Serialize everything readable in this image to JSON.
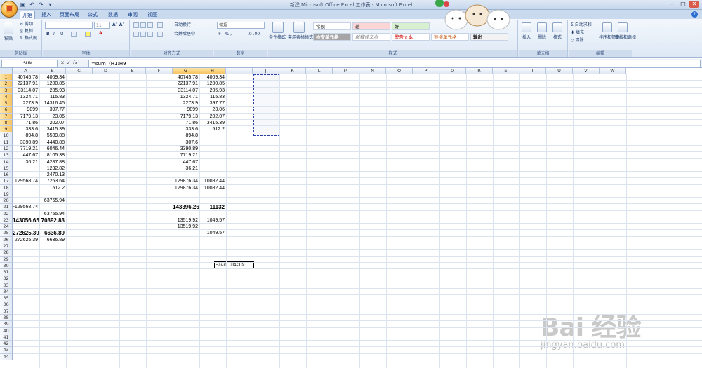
{
  "window": {
    "title": "新建 Microsoft Office Excel 工作表 - Microsoft Excel"
  },
  "tabs": [
    "开始",
    "插入",
    "页面布局",
    "公式",
    "数据",
    "审阅",
    "视图"
  ],
  "ribbon": {
    "clipboard": {
      "label": "剪贴板",
      "paste": "粘贴",
      "cut": "剪切",
      "copy": "复制",
      "format_painter": "格式刷"
    },
    "font": {
      "label": "字体",
      "size": "11"
    },
    "alignment": {
      "label": "对齐方式",
      "wrap": "自动换行",
      "merge": "合并后居中"
    },
    "number": {
      "label": "数字",
      "format": "常规"
    },
    "styles": {
      "label": "样式",
      "cond_format": "条件格式",
      "table_format": "套用表格格式",
      "cells": [
        "常规",
        "差",
        "好",
        "检查单元格",
        "解释性文本",
        "警告文本",
        "链接单元格",
        "输出"
      ]
    },
    "cells": {
      "label": "单元格",
      "insert": "插入",
      "delete": "删除",
      "format": "格式"
    },
    "editing": {
      "label": "编辑",
      "autosum": "自动求和",
      "fill": "填充",
      "clear": "清除",
      "sort": "排序和筛选",
      "find": "查找和选择"
    }
  },
  "formula_bar": {
    "name_box": "SUM",
    "formula": "=sum（H1:H9"
  },
  "columns": [
    "A",
    "B",
    "C",
    "D",
    "E",
    "F",
    "G",
    "H",
    "I",
    "J",
    "K",
    "L",
    "M",
    "N",
    "O",
    "P",
    "Q",
    "R",
    "S",
    "T",
    "U",
    "V",
    "W"
  ],
  "rows": [
    "1",
    "2",
    "3",
    "4",
    "5",
    "6",
    "7",
    "8",
    "9",
    "10",
    "11",
    "12",
    "13",
    "14",
    "15",
    "16",
    "17",
    "18",
    "19",
    "20",
    "21",
    "22",
    "23",
    "24",
    "25",
    "26",
    "27",
    "28",
    "29",
    "30",
    "31",
    "32",
    "33",
    "34",
    "35",
    "36",
    "37",
    "38",
    "39",
    "40",
    "41",
    "42",
    "43",
    "44"
  ],
  "cells": {
    "A": [
      "40745.78",
      "22137.91",
      "33114.07",
      "1324.71",
      "2273.9",
      "9899",
      "7179.13",
      "71.86",
      "333.6",
      "894.8",
      "3390.89",
      "7719.21",
      "447.67",
      "36.21",
      "",
      "",
      "129568.74",
      "",
      "",
      "",
      "-129568.74",
      "",
      "143056.65",
      "",
      "272625.39",
      "272625.39"
    ],
    "B": [
      "4009.34",
      "1200.85",
      "205.93",
      "115.83",
      "14316.45",
      "397.77",
      "23.06",
      "202.07",
      "3415.39",
      "5509.88",
      "4440.88",
      "6046.44",
      "8105.38",
      "4287.88",
      "1232.82",
      "2470.13",
      "7263.64",
      "512.2",
      "",
      "63755.94",
      "",
      "63755.94",
      "70392.83",
      "",
      "6636.89",
      "6636.89"
    ],
    "G": [
      "40745.78",
      "22137.91",
      "33114.07",
      "1324.71",
      "2273.9",
      "9899",
      "7179.13",
      "71.86",
      "333.6",
      "894.8",
      "307.6",
      "3390.89",
      "7719.21",
      "447.67",
      "36.21",
      "",
      "129876.34",
      "129876.34",
      "",
      "",
      "143396.26",
      "",
      "13519.92",
      "13519.92",
      "",
      ""
    ],
    "H": [
      "4009.34",
      "1200.85",
      "205.93",
      "115.83",
      "397.77",
      "23.06",
      "202.07",
      "3415.39",
      "512.2",
      "",
      "",
      "",
      "",
      "",
      "",
      "",
      "10082.44",
      "10082.44",
      "",
      "",
      "11132",
      "",
      "1049.57",
      "",
      "1049.57",
      ""
    ]
  },
  "bold_rows": {
    "A": [
      23,
      25
    ],
    "B": [
      23,
      25
    ],
    "G": [
      21
    ],
    "H": [
      21
    ]
  },
  "watermark": {
    "brand": "Bai 经验",
    "url": "jingyan.baidu.com"
  }
}
